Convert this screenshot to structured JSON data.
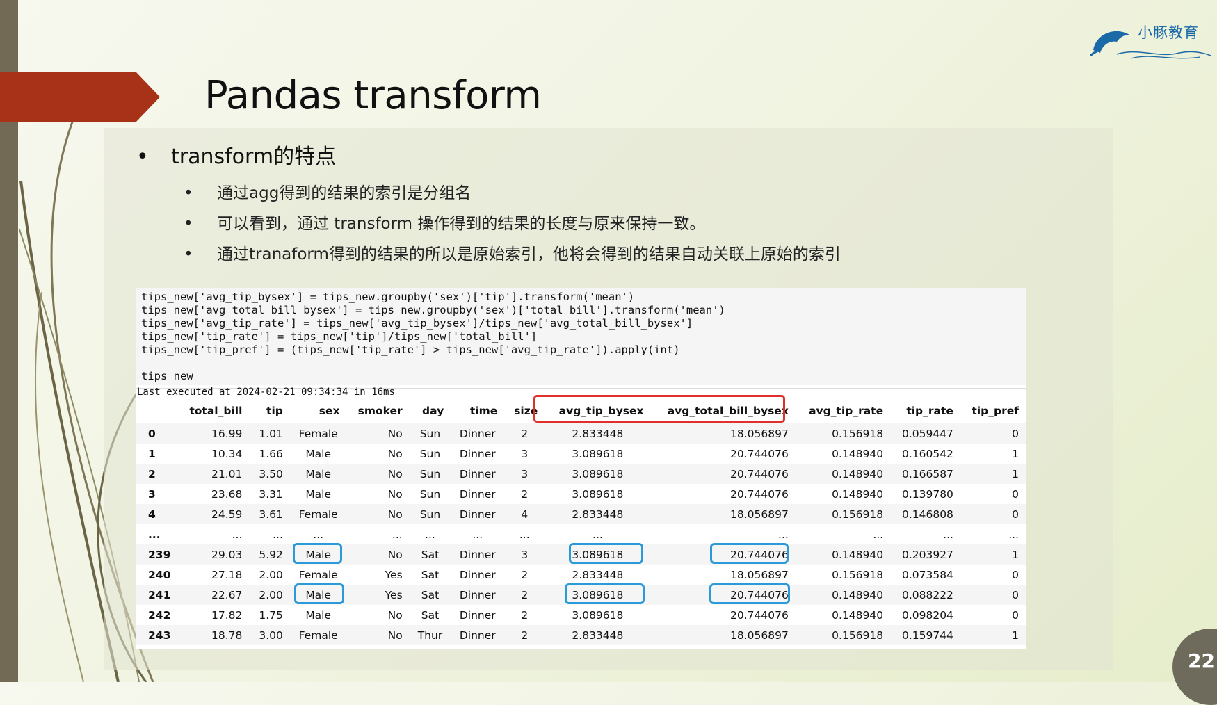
{
  "slide": {
    "title": "Pandas transform",
    "logo_text": "小豚教育",
    "page_number": "22",
    "colors": {
      "accent_red": "#a83217",
      "left_bar": "#736a55",
      "highlight_red": "#e0302a",
      "highlight_blue": "#2a9ad8"
    }
  },
  "bullets": {
    "level1": "transform的特点",
    "dot": "•",
    "level2": [
      "通过agg得到的结果的索引是分组名",
      "可以看到，通过 transform 操作得到的结果的长度与原来保持一致。",
      "通过tranaform得到的结果的所以是原始索引，他将会得到的结果自动关联上原始的索引"
    ]
  },
  "notebook": {
    "code_lines": [
      "tips_new['avg_tip_bysex'] = tips_new.groupby('sex')['tip'].transform('mean')",
      "tips_new['avg_total_bill_bysex'] = tips_new.groupby('sex')['total_bill'].transform('mean')",
      "tips_new['avg_tip_rate'] = tips_new['avg_tip_bysex']/tips_new['avg_total_bill_bysex']",
      "tips_new['tip_rate'] = tips_new['tip']/tips_new['total_bill']",
      "tips_new['tip_pref'] = (tips_new['tip_rate'] > tips_new['avg_tip_rate']).apply(int)",
      "",
      "tips_new"
    ],
    "exec_status": "Last executed at 2024-02-21 09:34:34 in 16ms",
    "table": {
      "columns": [
        "",
        "total_bill",
        "tip",
        "sex",
        "smoker",
        "day",
        "time",
        "size",
        "avg_tip_bysex",
        "avg_total_bill_bysex",
        "avg_tip_rate",
        "tip_rate",
        "tip_pref"
      ],
      "rows": [
        [
          "0",
          "16.99",
          "1.01",
          "Female",
          "No",
          "Sun",
          "Dinner",
          "2",
          "2.833448",
          "18.056897",
          "0.156918",
          "0.059447",
          "0"
        ],
        [
          "1",
          "10.34",
          "1.66",
          "Male",
          "No",
          "Sun",
          "Dinner",
          "3",
          "3.089618",
          "20.744076",
          "0.148940",
          "0.160542",
          "1"
        ],
        [
          "2",
          "21.01",
          "3.50",
          "Male",
          "No",
          "Sun",
          "Dinner",
          "3",
          "3.089618",
          "20.744076",
          "0.148940",
          "0.166587",
          "1"
        ],
        [
          "3",
          "23.68",
          "3.31",
          "Male",
          "No",
          "Sun",
          "Dinner",
          "2",
          "3.089618",
          "20.744076",
          "0.148940",
          "0.139780",
          "0"
        ],
        [
          "4",
          "24.59",
          "3.61",
          "Female",
          "No",
          "Sun",
          "Dinner",
          "4",
          "2.833448",
          "18.056897",
          "0.156918",
          "0.146808",
          "0"
        ],
        [
          "...",
          "...",
          "...",
          "...",
          "...",
          "...",
          "...",
          "...",
          "...",
          "...",
          "...",
          "...",
          "..."
        ],
        [
          "239",
          "29.03",
          "5.92",
          "Male",
          "No",
          "Sat",
          "Dinner",
          "3",
          "3.089618",
          "20.744076",
          "0.148940",
          "0.203927",
          "1"
        ],
        [
          "240",
          "27.18",
          "2.00",
          "Female",
          "Yes",
          "Sat",
          "Dinner",
          "2",
          "2.833448",
          "18.056897",
          "0.156918",
          "0.073584",
          "0"
        ],
        [
          "241",
          "22.67",
          "2.00",
          "Male",
          "Yes",
          "Sat",
          "Dinner",
          "2",
          "3.089618",
          "20.744076",
          "0.148940",
          "0.088222",
          "0"
        ],
        [
          "242",
          "17.82",
          "1.75",
          "Male",
          "No",
          "Sat",
          "Dinner",
          "2",
          "3.089618",
          "20.744076",
          "0.148940",
          "0.098204",
          "0"
        ],
        [
          "243",
          "18.78",
          "3.00",
          "Female",
          "No",
          "Thur",
          "Dinner",
          "2",
          "2.833448",
          "18.056897",
          "0.156918",
          "0.159744",
          "1"
        ]
      ]
    }
  }
}
